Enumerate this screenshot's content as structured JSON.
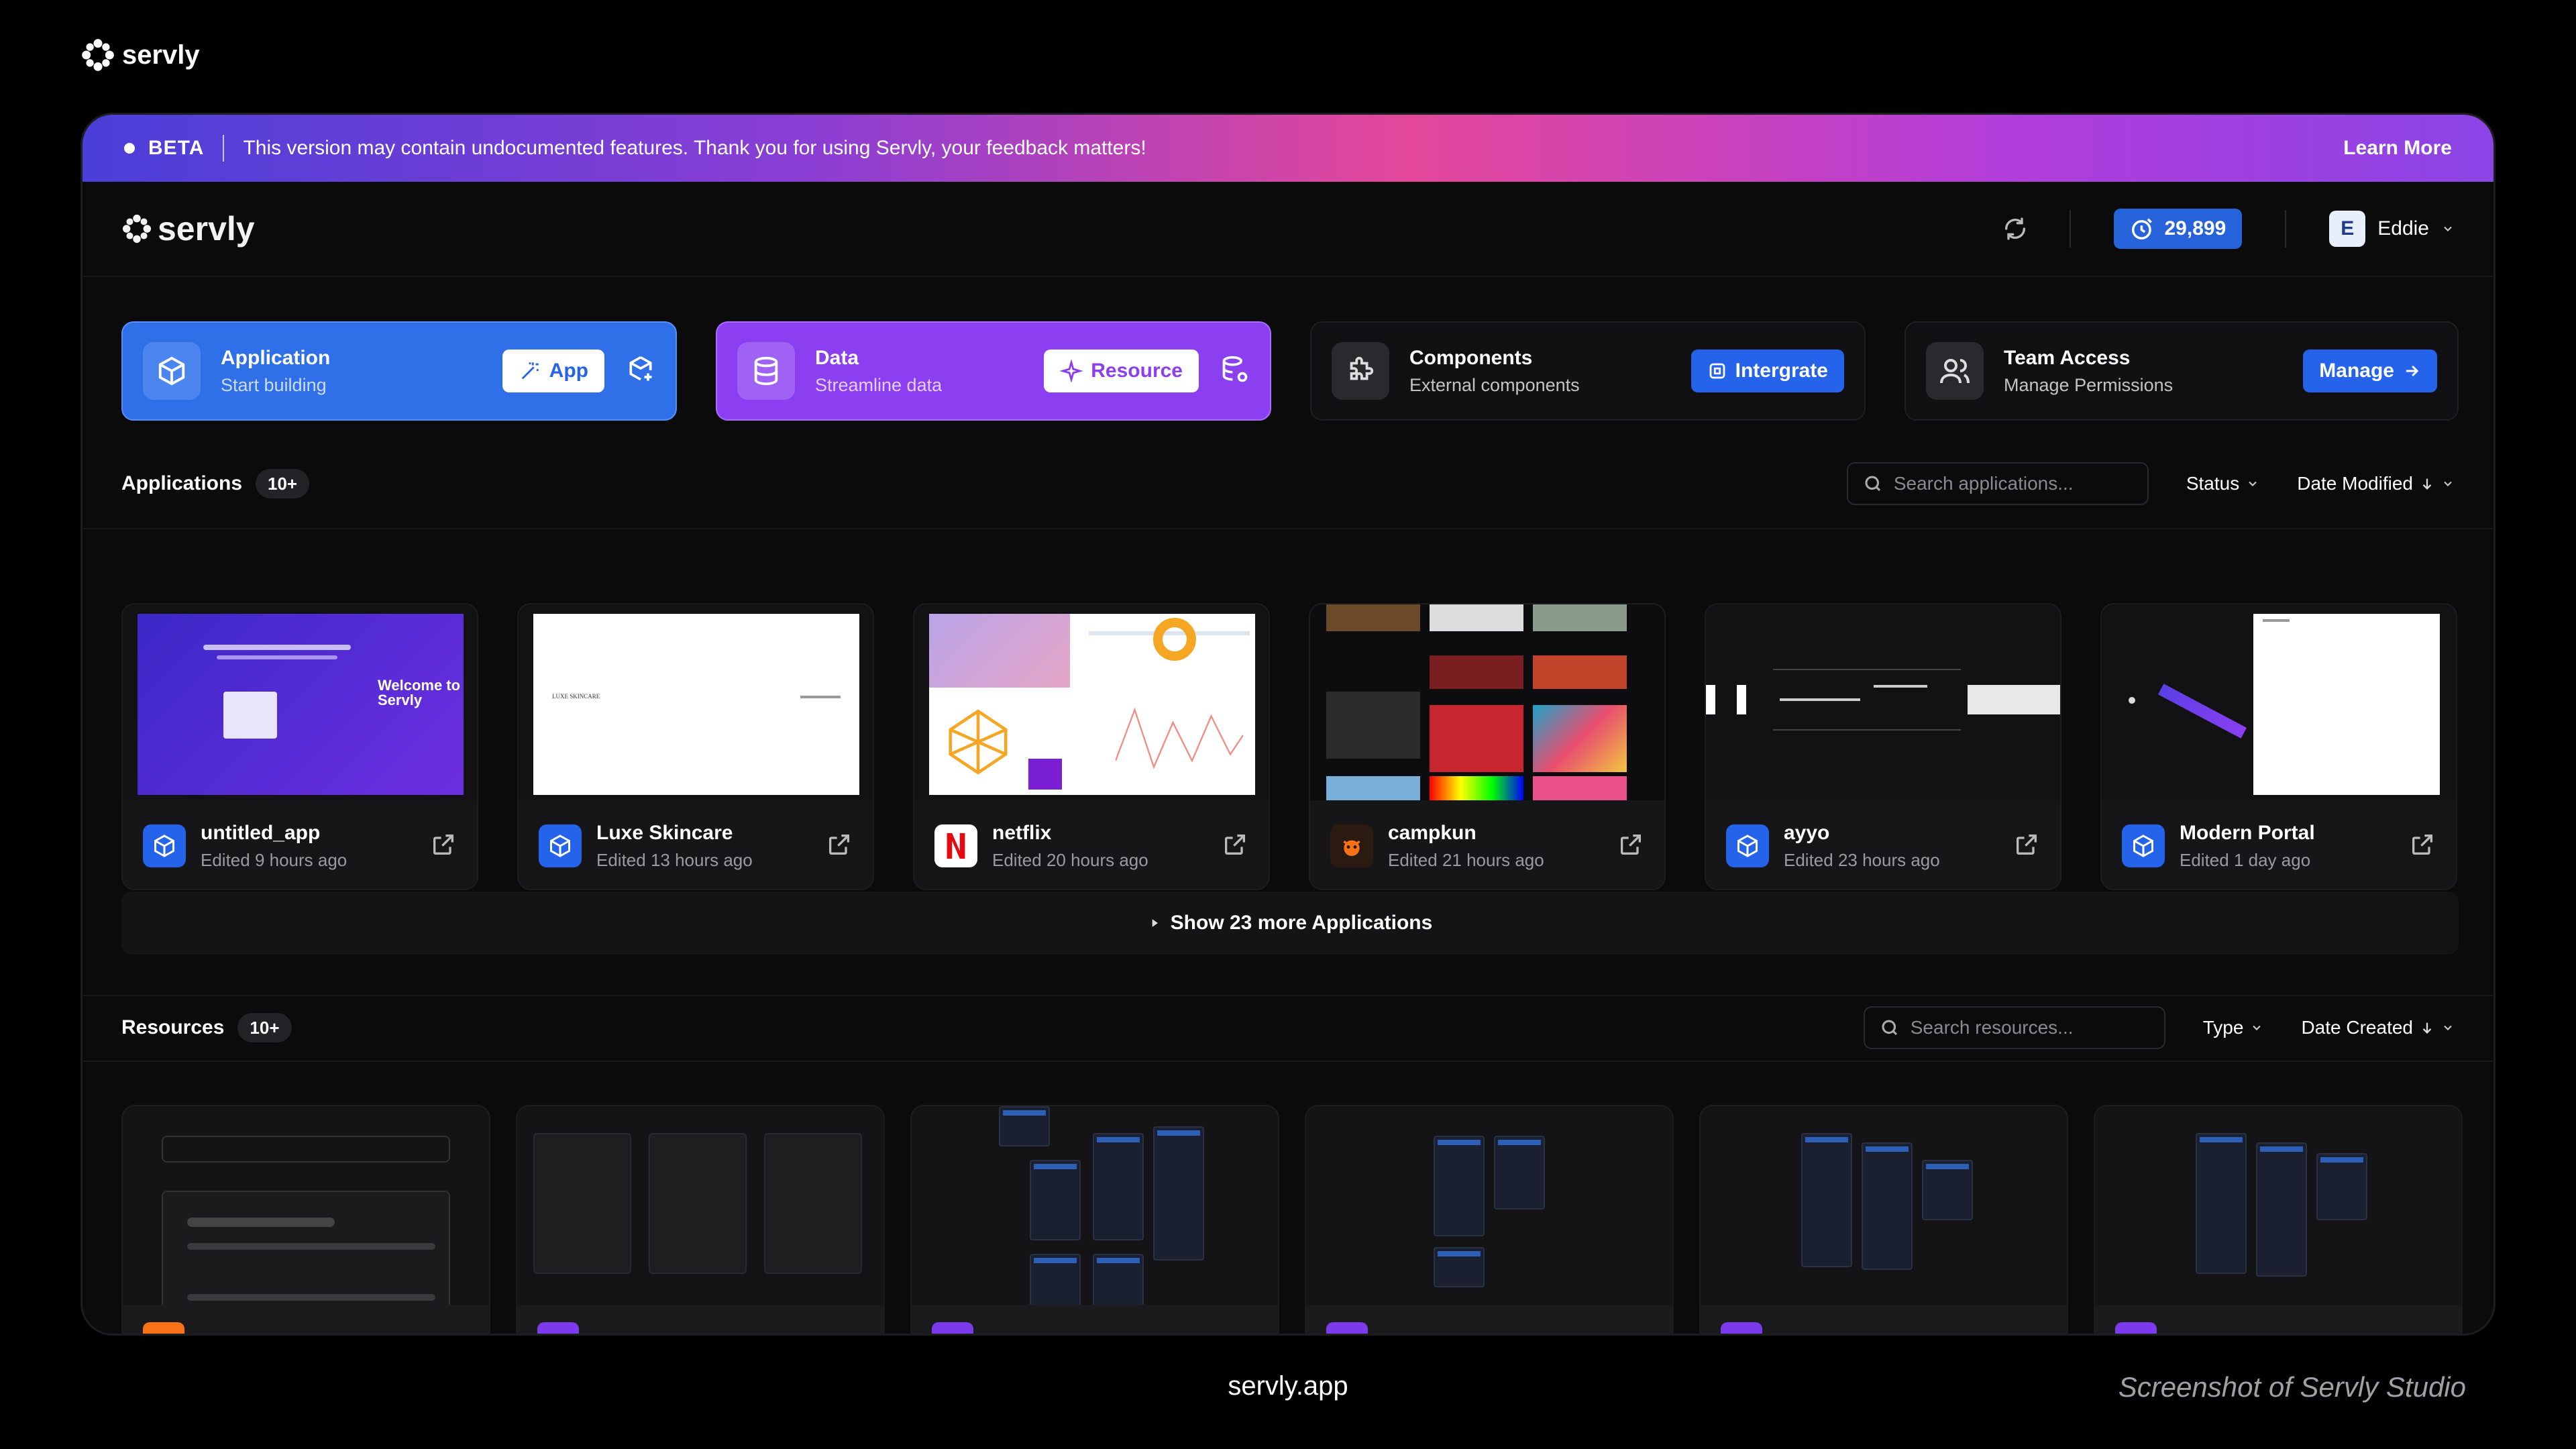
{
  "outer": {
    "brand": "servly",
    "footer_url": "servly.app",
    "footer_note": "Screenshot of Servly Studio"
  },
  "beta": {
    "tag": "BETA",
    "message": "This version may contain undocumented features. Thank you for using Servly, your feedback matters!",
    "learn_more": "Learn More"
  },
  "topbar": {
    "brand": "servly",
    "credits": "29,899",
    "user_initial": "E",
    "user_name": "Eddie"
  },
  "quick": [
    {
      "title": "Application",
      "subtitle": "Start building",
      "button": "App"
    },
    {
      "title": "Data",
      "subtitle": "Streamline data",
      "button": "Resource"
    },
    {
      "title": "Components",
      "subtitle": "External components",
      "button": "Intergrate"
    },
    {
      "title": "Team Access",
      "subtitle": "Manage Permissions",
      "button": "Manage"
    }
  ],
  "applications": {
    "title": "Applications",
    "count": "10+",
    "search_placeholder": "Search applications...",
    "filter_status": "Status",
    "sort": "Date Modified",
    "items": [
      {
        "name": "untitled_app",
        "edited": "Edited 9 hours ago",
        "thumb_text": "Welcome to Servly"
      },
      {
        "name": "Luxe Skincare",
        "edited": "Edited 13 hours ago",
        "thumb_text": "LUXE SKINCARE"
      },
      {
        "name": "netflix",
        "edited": "Edited 20 hours ago"
      },
      {
        "name": "campkun",
        "edited": "Edited 21 hours ago"
      },
      {
        "name": "ayyo",
        "edited": "Edited 23 hours ago"
      },
      {
        "name": "Modern Portal",
        "edited": "Edited 1 day ago"
      }
    ],
    "show_more": "Show 23 more Applications"
  },
  "resources": {
    "title": "Resources",
    "count": "10+",
    "search_placeholder": "Search resources...",
    "filter_type": "Type",
    "sort": "Date Created"
  },
  "colors": {
    "accent_blue": "#2563eb",
    "accent_purple": "#8b3ff0",
    "netflix_red": "#e50914",
    "campkun_orange": "#f97316"
  }
}
